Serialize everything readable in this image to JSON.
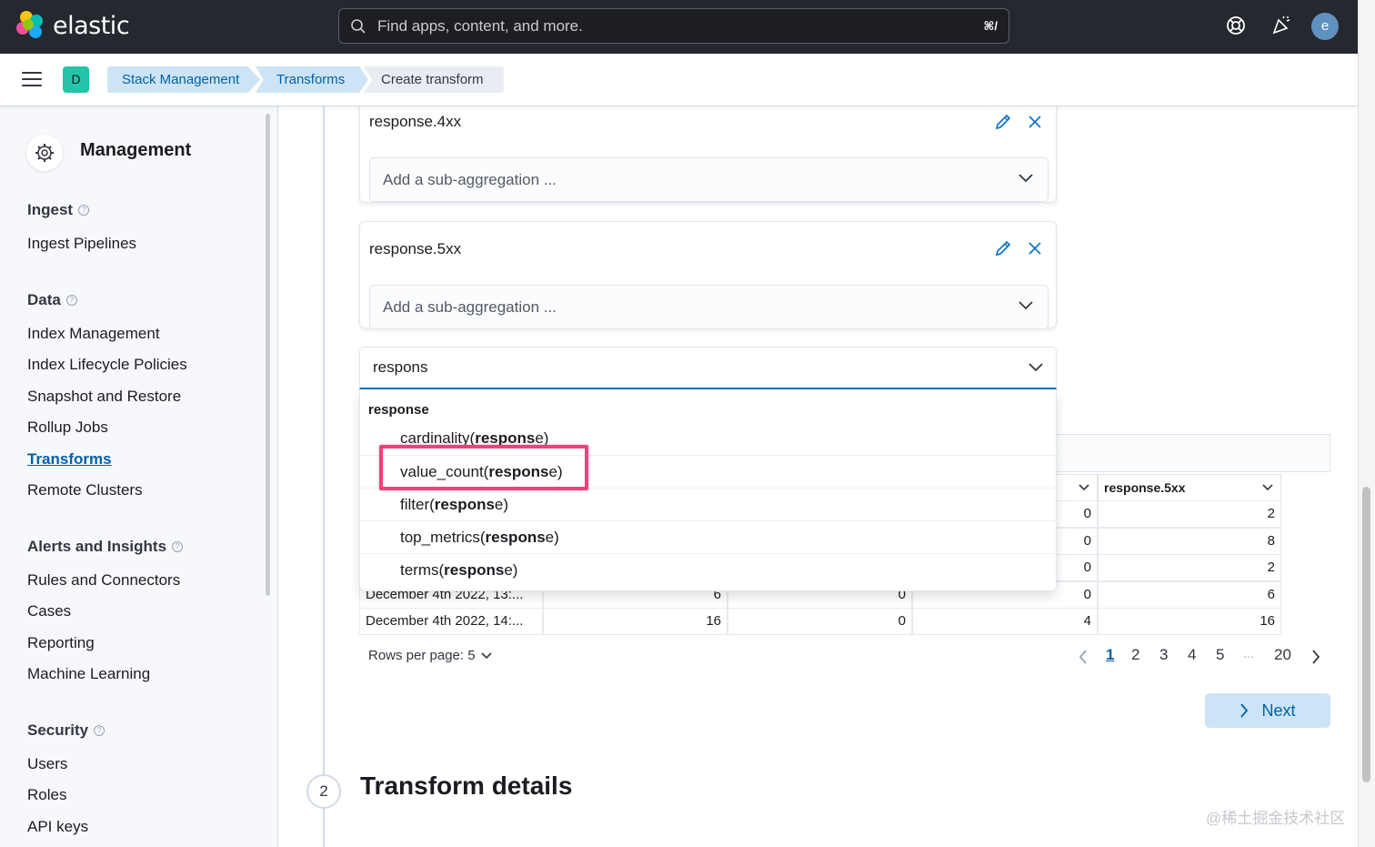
{
  "header": {
    "logo_text": "elastic",
    "search_placeholder": "Find apps, content, and more.",
    "search_shortcut": "⌘/",
    "avatar_letter": "e"
  },
  "breadcrumbs": {
    "space_letter": "D",
    "items": [
      "Stack Management",
      "Transforms",
      "Create transform"
    ]
  },
  "sidebar": {
    "title": "Management",
    "sections": [
      {
        "heading": "Ingest",
        "items": [
          "Ingest Pipelines"
        ]
      },
      {
        "heading": "Data",
        "items": [
          "Index Management",
          "Index Lifecycle Policies",
          "Snapshot and Restore",
          "Rollup Jobs",
          "Transforms",
          "Remote Clusters"
        ]
      },
      {
        "heading": "Alerts and Insights",
        "items": [
          "Rules and Connectors",
          "Cases",
          "Reporting",
          "Machine Learning"
        ]
      },
      {
        "heading": "Security",
        "items": [
          "Users",
          "Roles",
          "API keys"
        ]
      }
    ],
    "active_item": "Transforms"
  },
  "aggregations": [
    {
      "name": "response.4xx",
      "sub_placeholder": "Add a sub-aggregation ..."
    },
    {
      "name": "response.5xx",
      "sub_placeholder": "Add a sub-aggregation ..."
    }
  ],
  "combo": {
    "value": "respons"
  },
  "dropdown": {
    "group": "response",
    "options": [
      {
        "prefix": "cardinality(",
        "match": "respons",
        "suffix": "e)"
      },
      {
        "prefix": "value_count(",
        "match": "respons",
        "suffix": "e)"
      },
      {
        "prefix": "filter(",
        "match": "respons",
        "suffix": "e)"
      },
      {
        "prefix": "top_metrics(",
        "match": "respons",
        "suffix": "e)"
      },
      {
        "prefix": "terms(",
        "match": "respons",
        "suffix": "e)"
      }
    ],
    "highlighted_option": "value_count(response)"
  },
  "table": {
    "visible_header": "response.5xx",
    "rows": [
      {
        "c1": "",
        "c2": "",
        "c3": "",
        "c4": "0",
        "c5": "2"
      },
      {
        "c1": "",
        "c2": "",
        "c3": "",
        "c4": "0",
        "c5": "8"
      },
      {
        "c1": "",
        "c2": "",
        "c3": "",
        "c4": "0",
        "c5": "2"
      },
      {
        "c1": "December 4th 2022, 13:...",
        "c2": "6",
        "c3": "0",
        "c4": "0",
        "c5": "6"
      },
      {
        "c1": "December 4th 2022, 14:...",
        "c2": "16",
        "c3": "0",
        "c4": "4",
        "c5": "16"
      }
    ],
    "rows_per_page_label": "Rows per page: 5",
    "pages": [
      "1",
      "2",
      "3",
      "4",
      "5",
      "...",
      "20"
    ],
    "current_page": "1"
  },
  "next_button": "Next",
  "step2": {
    "number": "2",
    "title": "Transform details"
  },
  "watermark": "@稀土掘金技术社区"
}
